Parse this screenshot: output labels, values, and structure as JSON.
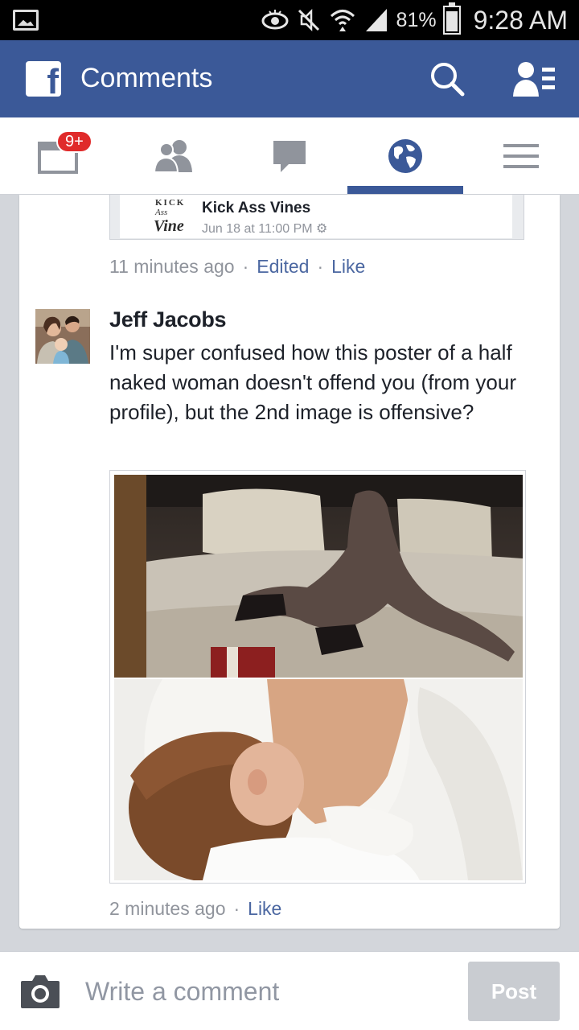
{
  "status_bar": {
    "battery": "81%",
    "time": "9:28 AM",
    "icons": [
      "image-icon",
      "eye-icon",
      "mute-icon",
      "wifi-icon",
      "signal-icon",
      "battery-icon"
    ]
  },
  "header": {
    "logo": "f",
    "title": "Comments",
    "icons": [
      "search-icon",
      "friend-requests-icon"
    ]
  },
  "tabs": [
    {
      "name": "news-feed",
      "icon": "news-feed-icon",
      "badge": "9+"
    },
    {
      "name": "friends",
      "icon": "friends-icon"
    },
    {
      "name": "messages",
      "icon": "messages-icon"
    },
    {
      "name": "notifications",
      "icon": "globe-icon",
      "active": true
    },
    {
      "name": "more",
      "icon": "menu-icon"
    }
  ],
  "shared_post": {
    "logo_text": [
      "KICK",
      "Ass",
      "Vine"
    ],
    "name": "Kick Ass Vines",
    "time": "Jun 18 at 11:00 PM"
  },
  "first_comment_meta": {
    "time": "11 minutes ago",
    "edited": "Edited",
    "like": "Like"
  },
  "comment": {
    "author": "Jeff Jacobs",
    "text": "I'm super confused how this poster of a half naked woman doesn't offend you (from your profile), but the 2nd image is offensive?",
    "time": "2 minutes ago",
    "like": "Like"
  },
  "composer": {
    "placeholder": "Write a comment",
    "post_label": "Post"
  },
  "colors": {
    "brand": "#3b5998",
    "link": "#4b67a1",
    "badge": "#e02a2a",
    "meta": "#90949c"
  }
}
